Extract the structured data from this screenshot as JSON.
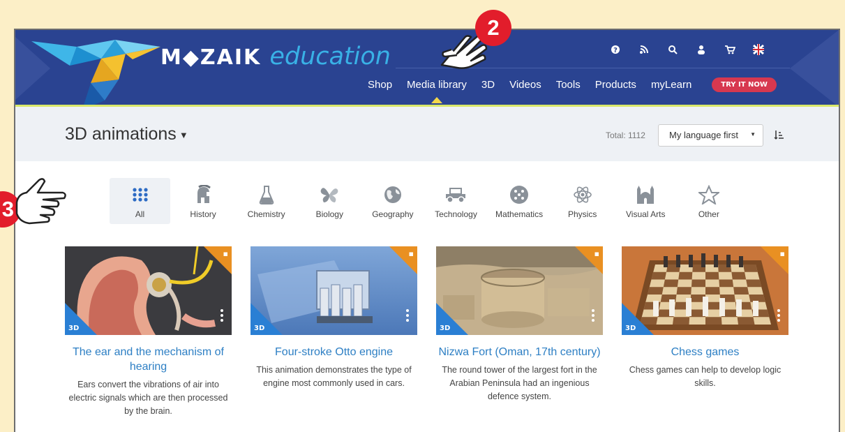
{
  "header": {
    "brand": "M◆ZAIK",
    "brand_suffix": "education",
    "utility_icons": [
      "help-icon",
      "rss-icon",
      "search-icon",
      "user-icon",
      "cart-icon",
      "uk-flag-icon"
    ],
    "nav": [
      "Shop",
      "Media library",
      "3D",
      "Videos",
      "Tools",
      "Products",
      "myLearn"
    ],
    "active_nav": "Media library",
    "try_button": "TRY IT NOW"
  },
  "subheader": {
    "title": "3D animations",
    "total": "Total: 1112",
    "sort_value": "My language first"
  },
  "categories": [
    {
      "label": "All",
      "icon": "grid-icon"
    },
    {
      "label": "History",
      "icon": "helmet-icon"
    },
    {
      "label": "Chemistry",
      "icon": "flask-icon"
    },
    {
      "label": "Biology",
      "icon": "butterfly-icon"
    },
    {
      "label": "Geography",
      "icon": "globe-icon"
    },
    {
      "label": "Technology",
      "icon": "car-icon"
    },
    {
      "label": "Mathematics",
      "icon": "dice-icon"
    },
    {
      "label": "Physics",
      "icon": "atom-icon"
    },
    {
      "label": "Visual Arts",
      "icon": "building-icon"
    },
    {
      "label": "Other",
      "icon": "star-icon"
    }
  ],
  "cards": [
    {
      "title": "The ear and the mechanism of hearing",
      "desc": "Ears convert the vibrations of air into electric signals which are then processed by the brain.",
      "badge": "3D"
    },
    {
      "title": "Four-stroke Otto engine",
      "desc": "This animation demonstrates the type of engine most commonly used in cars.",
      "badge": "3D"
    },
    {
      "title": "Nizwa Fort (Oman, 17th century)",
      "desc": "The round tower of the largest fort in the Arabian Peninsula had an ingenious defence system.",
      "badge": "3D"
    },
    {
      "title": "Chess games",
      "desc": "Chess games can help to develop logic skills.",
      "badge": "3D"
    }
  ],
  "annotations": {
    "step_2": "2",
    "step_3": "3"
  },
  "colors": {
    "header_bg": "#2a4391",
    "accent_link": "#2d7fc4",
    "badge_red": "#e21d2b",
    "corner_orange": "#e99022",
    "badge_blue": "#2a7fd4"
  }
}
